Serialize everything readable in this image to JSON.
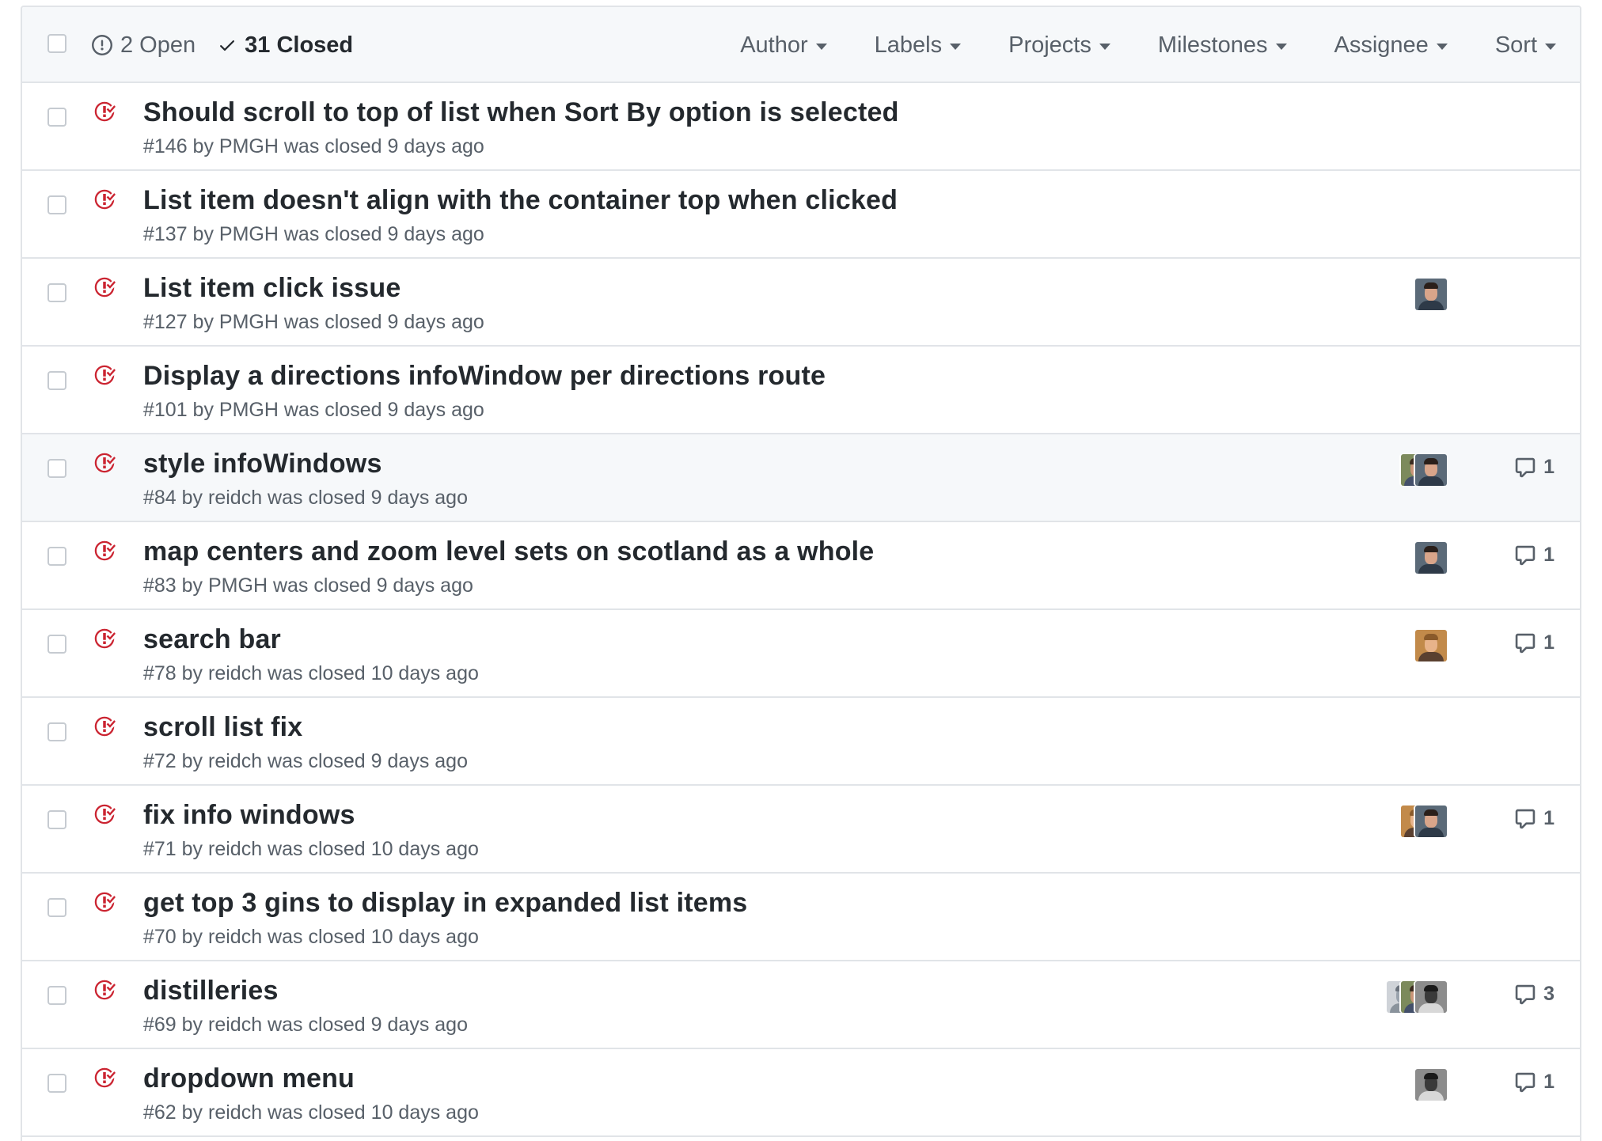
{
  "header": {
    "open_label": "2 Open",
    "closed_label": "31 Closed",
    "filters": [
      "Author",
      "Labels",
      "Projects",
      "Milestones",
      "Assignee",
      "Sort"
    ]
  },
  "colors": {
    "closed_icon": "#cb2431",
    "border": "#e1e4e8",
    "header_bg": "#f6f8fa",
    "muted_text": "#586069"
  },
  "issues": [
    {
      "title": "Should scroll to top of list when Sort By option is selected",
      "meta": "#146 by PMGH was closed 9 days ago",
      "avatars": [],
      "comments": ""
    },
    {
      "title": "List item doesn't align with the container top when clicked",
      "meta": "#137 by PMGH was closed 9 days ago",
      "avatars": [],
      "comments": ""
    },
    {
      "title": "List item click issue",
      "meta": "#127 by PMGH was closed 9 days ago",
      "avatars": [
        "dark-curly"
      ],
      "comments": ""
    },
    {
      "title": "Display a directions infoWindow per directions route",
      "meta": "#101 by PMGH was closed 9 days ago",
      "avatars": [],
      "comments": ""
    },
    {
      "title": "style infoWindows",
      "meta": "#84 by reidch was closed 9 days ago",
      "avatars": [
        "outdoor",
        "dark-curly"
      ],
      "comments": "1"
    },
    {
      "title": "map centers and zoom level sets on scotland as a whole",
      "meta": "#83 by PMGH was closed 9 days ago",
      "avatars": [
        "dark-curly"
      ],
      "comments": "1"
    },
    {
      "title": "search bar",
      "meta": "#78 by reidch was closed 10 days ago",
      "avatars": [
        "warm-light"
      ],
      "comments": "1"
    },
    {
      "title": "scroll list fix",
      "meta": "#72 by reidch was closed 9 days ago",
      "avatars": [],
      "comments": ""
    },
    {
      "title": "fix info windows",
      "meta": "#71 by reidch was closed 10 days ago",
      "avatars": [
        "warm-light",
        "dark-curly"
      ],
      "comments": "1"
    },
    {
      "title": "get top 3 gins to display in expanded list items",
      "meta": "#70 by reidch was closed 10 days ago",
      "avatars": [],
      "comments": ""
    },
    {
      "title": "distilleries",
      "meta": "#69 by reidch was closed 9 days ago",
      "avatars": [
        "gray-stripe",
        "outdoor",
        "bw"
      ],
      "comments": "3"
    },
    {
      "title": "dropdown menu",
      "meta": "#62 by reidch was closed 10 days ago",
      "avatars": [
        "bw"
      ],
      "comments": "1"
    }
  ]
}
